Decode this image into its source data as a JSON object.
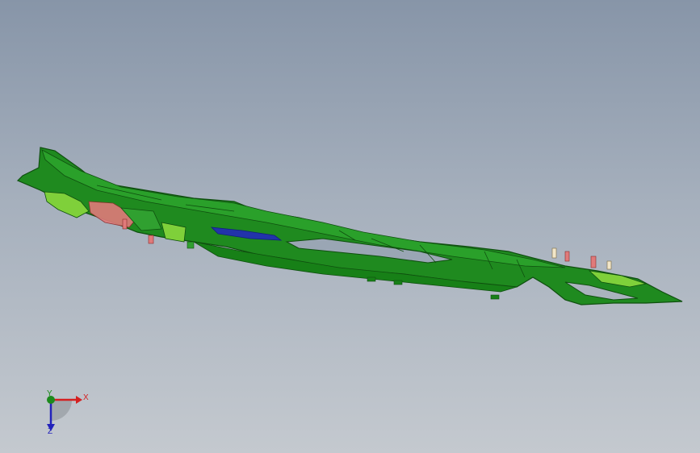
{
  "viewport": {
    "background_top": "#8795a8",
    "background_bottom": "#c4c9cf"
  },
  "model": {
    "body_color": "#1f8a1f",
    "body_dark": "#0f4f0f",
    "highlight_color": "#7fd03a",
    "detail_color": "#e07a7a",
    "accent_color": "#2233aa"
  },
  "triad": {
    "x_label": "X",
    "y_label": "Y",
    "z_label": "Z",
    "x_color": "#d42020",
    "y_color": "#1c8a1c",
    "z_color": "#2222bb"
  }
}
